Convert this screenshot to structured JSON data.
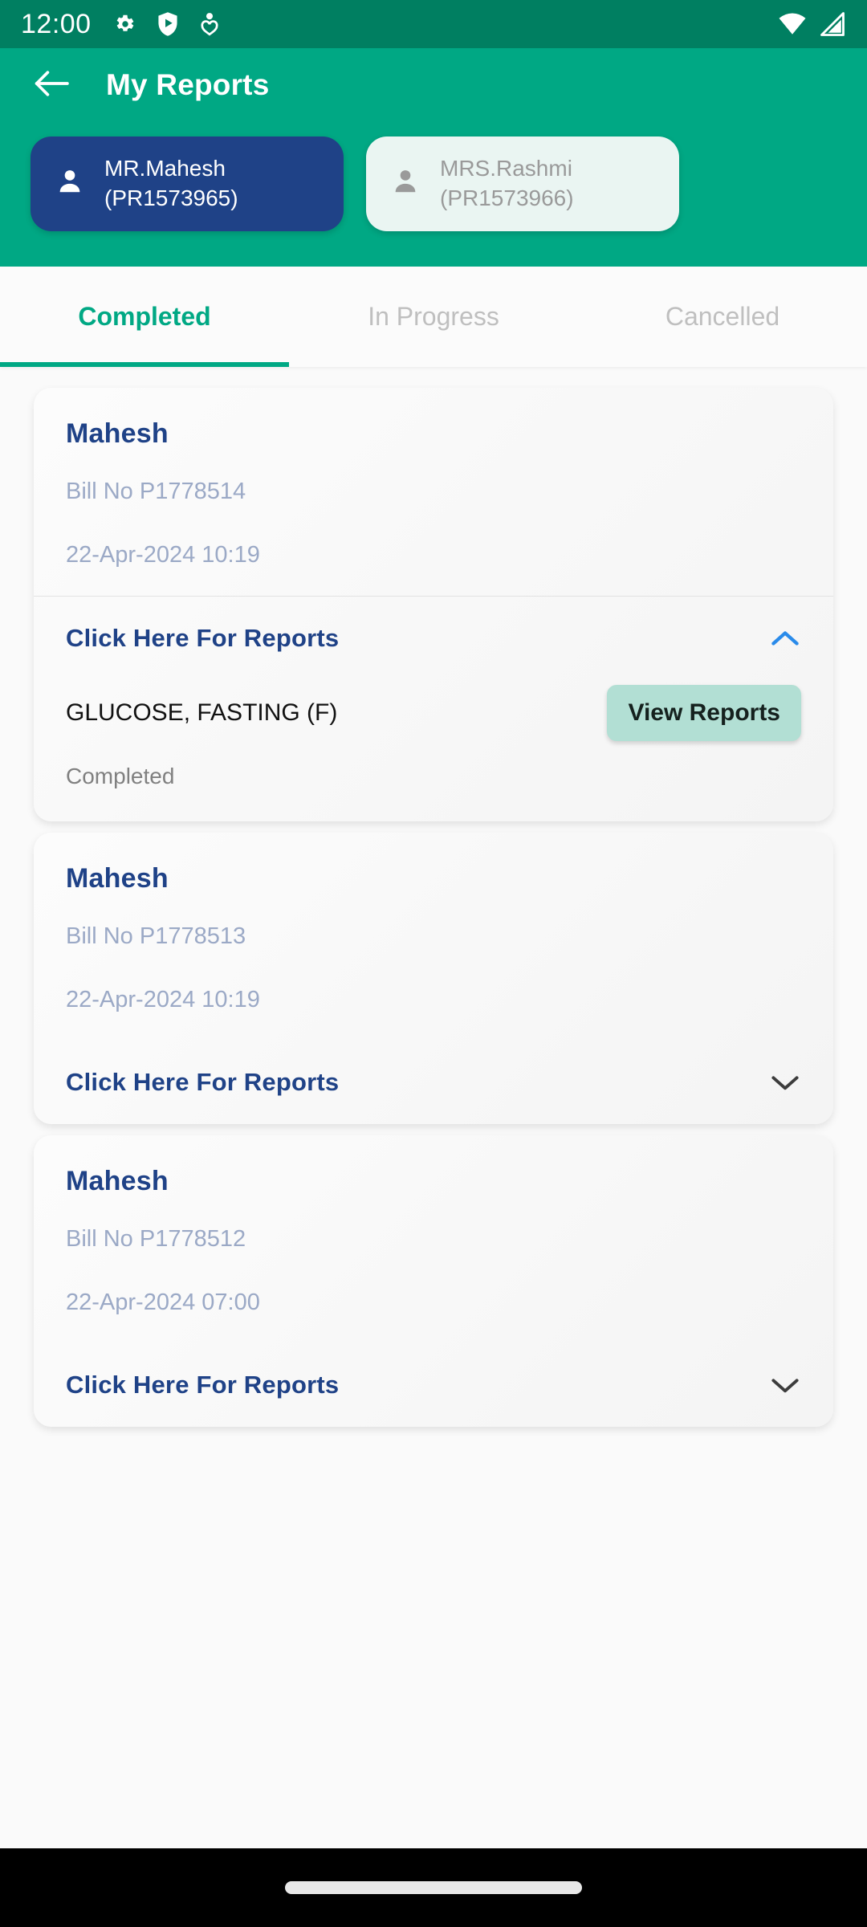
{
  "status_bar": {
    "clock": "12:00",
    "left_icons": [
      "gear-icon",
      "play-protect-shield-icon",
      "person-heart-icon"
    ],
    "right_icons": [
      "wifi-icon",
      "cellular-signal-icon"
    ],
    "background": "#007F61"
  },
  "app_bar": {
    "back_icon": "arrow-left-icon",
    "title": "My Reports",
    "background": "#00A884"
  },
  "patients": [
    {
      "line1": "MR.Mahesh",
      "line2": "(PR1573965)",
      "selected": true,
      "avatar_icon": "person-icon",
      "background": "#1F4287",
      "text_color": "#FFFFFF"
    },
    {
      "line1": "MRS.Rashmi",
      "line2": "(PR1573966)",
      "selected": false,
      "avatar_icon": "person-icon",
      "background": "#EAF5F2",
      "text_color": "#9A9A9A"
    }
  ],
  "tabs": [
    {
      "label": "Completed",
      "active": true
    },
    {
      "label": "In Progress",
      "active": false
    },
    {
      "label": "Cancelled",
      "active": false
    }
  ],
  "accent_color": "#00A884",
  "link_color": "#1F4287",
  "reports": [
    {
      "patient_name": "Mahesh",
      "bill_no": "Bill No P1778514",
      "datetime": "22-Apr-2024 10:19",
      "expand_label": "Click Here For Reports",
      "expanded": true,
      "chevron_icon": "chevron-up-icon",
      "chevron_color": "#2A8BEA",
      "tests": [
        {
          "name": "GLUCOSE, FASTING (F)",
          "button_label": "View Reports",
          "status": "Completed"
        }
      ]
    },
    {
      "patient_name": "Mahesh",
      "bill_no": "Bill No P1778513",
      "datetime": "22-Apr-2024 10:19",
      "expand_label": "Click Here For Reports",
      "expanded": false,
      "chevron_icon": "chevron-down-icon",
      "chevron_color": "#3C3C3C",
      "tests": []
    },
    {
      "patient_name": "Mahesh",
      "bill_no": "Bill No P1778512",
      "datetime": "22-Apr-2024 07:00",
      "expand_label": "Click Here For Reports",
      "expanded": false,
      "chevron_icon": "chevron-down-icon",
      "chevron_color": "#3C3C3C",
      "tests": []
    }
  ],
  "nav_bar": {
    "home_indicator": "home-indicator-pill"
  }
}
